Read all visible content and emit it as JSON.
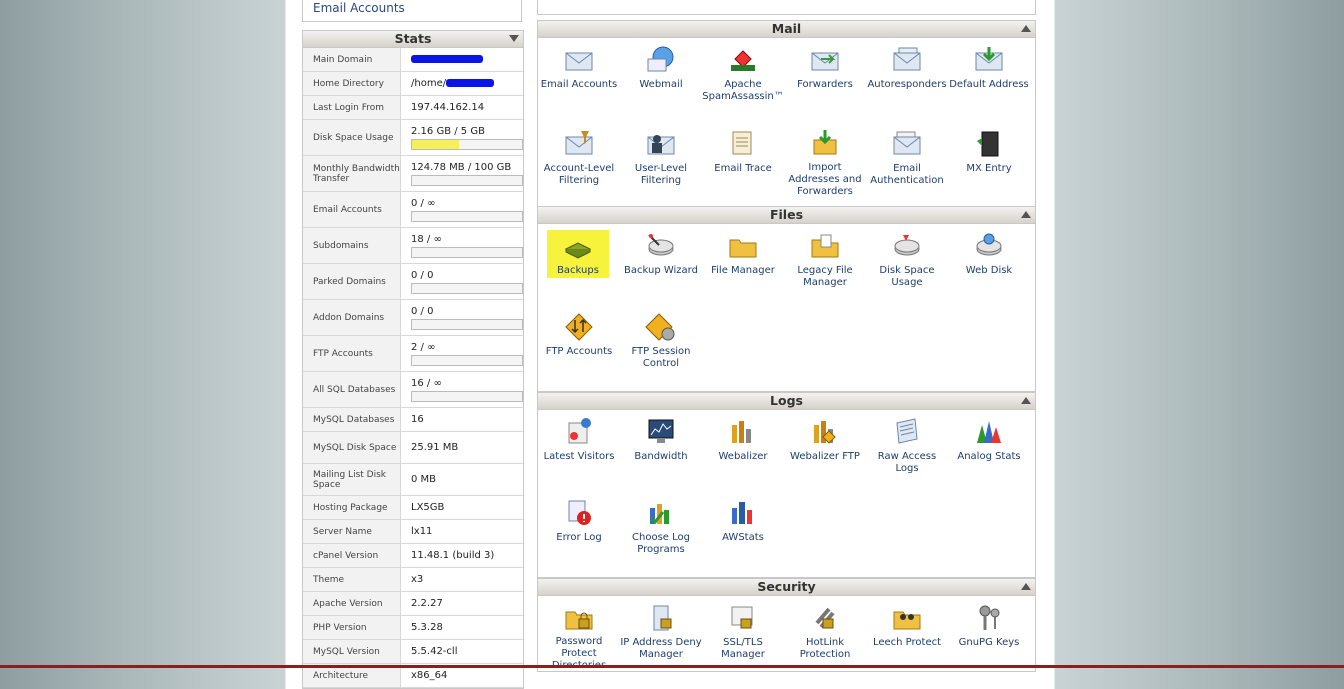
{
  "top_link": "Email Accounts",
  "stats": {
    "title": "Stats",
    "rows": [
      {
        "label": "Main Domain",
        "value": "",
        "redacted": true
      },
      {
        "label": "Home Directory",
        "value": "/home/",
        "redacted": true
      },
      {
        "label": "Last Login From",
        "value": "197.44.162.14"
      },
      {
        "label": "Disk Space Usage",
        "value": "2.16 GB / 5 GB",
        "progress": 0.43
      },
      {
        "label": "Monthly Bandwidth Transfer",
        "value": "124.78 MB / 100 GB",
        "progress": 0.0
      },
      {
        "label": "Email Accounts",
        "value": "0 / ∞",
        "progress": 0.0
      },
      {
        "label": "Subdomains",
        "value": "18 / ∞",
        "progress": 0.0
      },
      {
        "label": "Parked Domains",
        "value": "0 / 0",
        "progress": 0.0
      },
      {
        "label": "Addon Domains",
        "value": "0 / 0",
        "progress": 0.0
      },
      {
        "label": "FTP Accounts",
        "value": "2 / ∞",
        "progress": 0.0
      },
      {
        "label": "All SQL Databases",
        "value": "16 / ∞",
        "progress": 0.0
      },
      {
        "label": "MySQL Databases",
        "value": "16"
      },
      {
        "label": "MySQL Disk Space",
        "value": "25.91 MB"
      },
      {
        "label": "Mailing List Disk Space",
        "value": "0 MB"
      },
      {
        "label": "Hosting Package",
        "value": "LX5GB"
      },
      {
        "label": "Server Name",
        "value": "lx11"
      },
      {
        "label": "cPanel Version",
        "value": "11.48.1 (build 3)"
      },
      {
        "label": "Theme",
        "value": "x3"
      },
      {
        "label": "Apache Version",
        "value": "2.2.27"
      },
      {
        "label": "PHP Version",
        "value": "5.3.28"
      },
      {
        "label": "MySQL Version",
        "value": "5.5.42-cll"
      },
      {
        "label": "Architecture",
        "value": "x86_64"
      }
    ]
  },
  "panels": {
    "mail": {
      "title": "Mail",
      "items": [
        {
          "label": "Email Accounts",
          "icon": "envelope-icon"
        },
        {
          "label": "Webmail",
          "icon": "globe-envelope-icon"
        },
        {
          "label": "Apache SpamAssassin™",
          "icon": "spamassassin-icon"
        },
        {
          "label": "Forwarders",
          "icon": "forward-envelope-icon"
        },
        {
          "label": "Autoresponders",
          "icon": "autoresponder-icon"
        },
        {
          "label": "Default Address",
          "icon": "download-envelope-icon"
        },
        {
          "label": "Account-Level Filtering",
          "icon": "filter-envelope-icon"
        },
        {
          "label": "User-Level Filtering",
          "icon": "user-filter-icon"
        },
        {
          "label": "Email Trace",
          "icon": "trace-doc-icon"
        },
        {
          "label": "Import Addresses and Forwarders",
          "icon": "import-box-icon"
        },
        {
          "label": "Email Authentication",
          "icon": "auth-envelope-icon"
        },
        {
          "label": "MX Entry",
          "icon": "server-icon"
        }
      ]
    },
    "files": {
      "title": "Files",
      "items": [
        {
          "label": "Backups",
          "icon": "backup-disk-icon",
          "highlight": true
        },
        {
          "label": "Backup Wizard",
          "icon": "wizard-disk-icon"
        },
        {
          "label": "File Manager",
          "icon": "folder-icon"
        },
        {
          "label": "Legacy File Manager",
          "icon": "legacy-folder-icon"
        },
        {
          "label": "Disk Space Usage",
          "icon": "disk-usage-icon"
        },
        {
          "label": "Web Disk",
          "icon": "web-disk-icon"
        },
        {
          "label": "FTP Accounts",
          "icon": "ftp-icon"
        },
        {
          "label": "FTP Session Control",
          "icon": "ftp-gear-icon"
        }
      ]
    },
    "logs": {
      "title": "Logs",
      "items": [
        {
          "label": "Latest Visitors",
          "icon": "visitors-icon"
        },
        {
          "label": "Bandwidth",
          "icon": "bandwidth-monitor-icon"
        },
        {
          "label": "Webalizer",
          "icon": "webalizer-icon"
        },
        {
          "label": "Webalizer FTP",
          "icon": "webalizer-ftp-icon"
        },
        {
          "label": "Raw Access Logs",
          "icon": "raw-logs-icon"
        },
        {
          "label": "Analog Stats",
          "icon": "analog-stats-icon"
        },
        {
          "label": "Error Log",
          "icon": "error-log-icon"
        },
        {
          "label": "Choose Log Programs",
          "icon": "log-programs-icon"
        },
        {
          "label": "AWStats",
          "icon": "awstats-icon"
        }
      ]
    },
    "security": {
      "title": "Security",
      "items": [
        {
          "label": "Password Protect Directories",
          "icon": "password-folder-icon"
        },
        {
          "label": "IP Address Deny Manager",
          "icon": "ip-deny-icon"
        },
        {
          "label": "SSL/TLS Manager",
          "icon": "ssl-cert-icon"
        },
        {
          "label": "HotLink Protection",
          "icon": "hotlink-lock-icon"
        },
        {
          "label": "Leech Protect",
          "icon": "leech-folder-icon"
        },
        {
          "label": "GnuPG Keys",
          "icon": "keys-icon"
        }
      ]
    }
  }
}
